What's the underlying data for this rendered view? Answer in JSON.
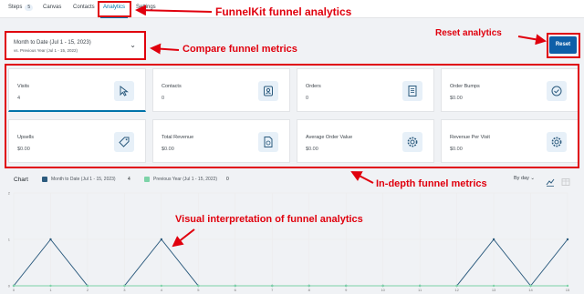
{
  "tabs": [
    {
      "label": "Steps",
      "badge": "5"
    },
    {
      "label": "Canvas"
    },
    {
      "label": "Contacts"
    },
    {
      "label": "Analytics"
    },
    {
      "label": "Settings"
    }
  ],
  "date_compare": {
    "primary": "Month to Date (Jul 1 - 15, 2023)",
    "secondary": "vs. Previous Year (Jul 1 - 15, 2022)"
  },
  "reset_label": "Reset",
  "metrics": [
    {
      "title": "Visits",
      "value": "4",
      "icon": "cursor-icon"
    },
    {
      "title": "Contacts",
      "value": "0",
      "icon": "contact-card-icon"
    },
    {
      "title": "Orders",
      "value": "0",
      "icon": "receipt-icon"
    },
    {
      "title": "Order Bumps",
      "value": "$0.00",
      "icon": "check-circle-icon"
    },
    {
      "title": "Upsells",
      "value": "$0.00",
      "icon": "tag-icon"
    },
    {
      "title": "Total Revenue",
      "value": "$0.00",
      "icon": "revenue-doc-icon"
    },
    {
      "title": "Average Order Value",
      "value": "$0.00",
      "icon": "gear-icon"
    },
    {
      "title": "Revenue Per Visit",
      "value": "$0.00",
      "icon": "gear-icon"
    }
  ],
  "chart": {
    "title": "Chart",
    "legend": [
      {
        "label": "Month to Date (Jul 1 - 15, 2023)",
        "count": "4",
        "color": "#2c5b7e"
      },
      {
        "label": "Previous Year (Jul 1 - 15, 2022)",
        "count": "0",
        "color": "#7dd3a8"
      }
    ],
    "range_select": "By day"
  },
  "chart_data": {
    "type": "line",
    "x": [
      0,
      1,
      2,
      3,
      4,
      5,
      6,
      7,
      8,
      9,
      10,
      11,
      12,
      13,
      14,
      15
    ],
    "series": [
      {
        "name": "Month to Date (Jul 1 - 15, 2023)",
        "values": [
          0,
          1,
          0,
          0,
          1,
          0,
          0,
          0,
          0,
          0,
          0,
          0,
          0,
          1,
          0,
          1
        ]
      },
      {
        "name": "Previous Year (Jul 1 - 15, 2022)",
        "values": [
          0,
          0,
          0,
          0,
          0,
          0,
          0,
          0,
          0,
          0,
          0,
          0,
          0,
          0,
          0,
          0
        ]
      }
    ],
    "ylim": [
      0,
      2
    ],
    "yticks": [
      "0",
      "1",
      "2"
    ],
    "grid": true
  },
  "annotations": {
    "analytics": "FunnelKit funnel analytics",
    "compare": "Compare funnel metrics",
    "reset": "Reset analytics",
    "metrics": "In-depth funnel metrics",
    "visual": "Visual interpretation of funnel analytics"
  }
}
